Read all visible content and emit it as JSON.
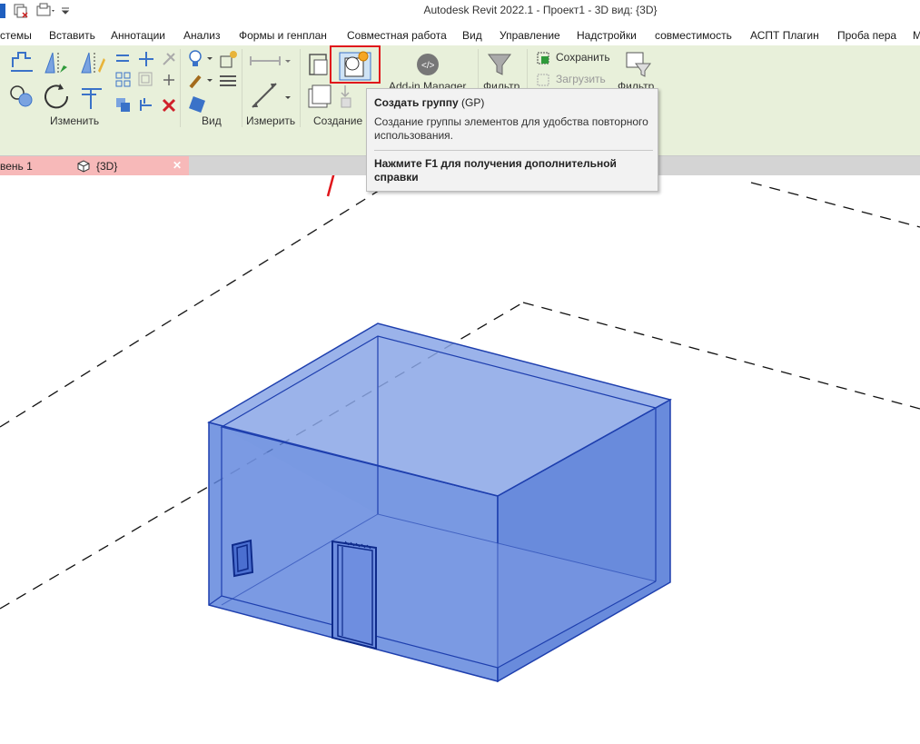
{
  "window": {
    "title": "Autodesk Revit 2022.1 - Проект1 - 3D вид: {3D}"
  },
  "menu": [
    "стемы",
    "Вставить",
    "Аннотации",
    "Анализ",
    "Формы и генплан",
    "Совместная работа",
    "Вид",
    "Управление",
    "Надстройки",
    "совместимость",
    "АСПТ Плагин",
    "Проба пера",
    "M"
  ],
  "ribbon": {
    "panels": {
      "modify": "Изменить",
      "view": "Вид",
      "measure": "Измерить",
      "create": "Создание"
    },
    "addin_manager": "Add-in Manager",
    "filter_label": "Фильтр",
    "filter_label2": "Фильтр",
    "save": "Сохранить",
    "load": "Загрузить"
  },
  "tooltip": {
    "title": "Создать группу",
    "shortcut": "(GP)",
    "description": "Создание группы элементов для удобства повторного использования.",
    "help": "Нажмите F1 для получения дополнительной справки"
  },
  "tabs": [
    {
      "label": "вень 1"
    },
    {
      "label": "{3D}",
      "close": "✕"
    }
  ],
  "colors": {
    "ribbon_bg": "#e8f0da",
    "tab_bg": "#f7b9b9",
    "highlight": "#e0161b",
    "selection_blue": "#2f5fd0"
  }
}
